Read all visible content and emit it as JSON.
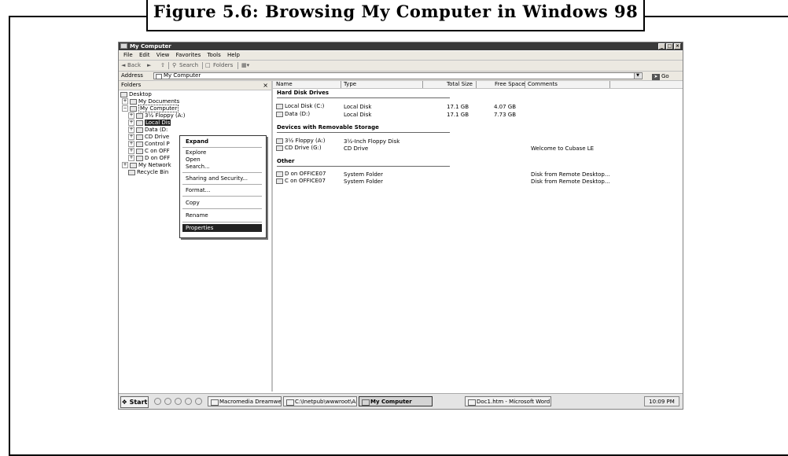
{
  "caption": "Figure 5.6: Browsing My Computer in Windows 98",
  "window": {
    "title": "My Computer",
    "controls": [
      "_",
      "□",
      "×"
    ]
  },
  "menu": [
    "File",
    "Edit",
    "View",
    "Favorites",
    "Tools",
    "Help"
  ],
  "toolbar": {
    "back": "Back",
    "search": "Search",
    "folders": "Folders"
  },
  "address": {
    "label": "Address",
    "value": "My Computer",
    "go": "Go"
  },
  "folders_pane": {
    "title": "Folders",
    "close": "×",
    "tree": [
      {
        "label": "Desktop",
        "exp": ""
      },
      {
        "label": "My Documents",
        "exp": "+"
      },
      {
        "label": "My Computer",
        "exp": "−"
      },
      {
        "label": "3½ Floppy (A:)",
        "exp": "+"
      },
      {
        "label": "Local Dis",
        "exp": "+"
      },
      {
        "label": "Data (D:",
        "exp": "+"
      },
      {
        "label": "CD Drive",
        "exp": "+"
      },
      {
        "label": "Control P",
        "exp": "+"
      },
      {
        "label": "C on OFF",
        "exp": "+"
      },
      {
        "label": "D on OFF",
        "exp": "+"
      },
      {
        "label": "My Network",
        "exp": "+"
      },
      {
        "label": "Recycle Bin",
        "exp": ""
      }
    ]
  },
  "context_menu": [
    "Expand",
    "Explore",
    "Open",
    "Search...",
    "Sharing and Security...",
    "Format...",
    "Copy",
    "Rename",
    "Properties"
  ],
  "columns": [
    "Name",
    "Type",
    "Total Size",
    "Free Space",
    "Comments"
  ],
  "groups": {
    "hard_disks": {
      "title": "Hard Disk Drives",
      "items": [
        {
          "name": "Local Disk (C:)",
          "type": "Local Disk",
          "total": "17.1 GB",
          "free": "4.07 GB",
          "comment": ""
        },
        {
          "name": "Data (D:)",
          "type": "Local Disk",
          "total": "17.1 GB",
          "free": "7.73 GB",
          "comment": ""
        }
      ]
    },
    "removable": {
      "title": "Devices with Removable Storage",
      "items": [
        {
          "name": "3½ Floppy (A:)",
          "type": "3½-Inch Floppy Disk",
          "total": "",
          "free": "",
          "comment": ""
        },
        {
          "name": "CD Drive (G:)",
          "type": "CD Drive",
          "total": "",
          "free": "",
          "comment": "Welcome to Cubase LE"
        }
      ]
    },
    "other": {
      "title": "Other",
      "items": [
        {
          "name": "D on OFFICE07",
          "type": "System Folder",
          "total": "",
          "free": "",
          "comment": "Disk from Remote Desktop..."
        },
        {
          "name": "C on OFFICE07",
          "type": "System Folder",
          "total": "",
          "free": "",
          "comment": "Disk from Remote Desktop..."
        }
      ]
    }
  },
  "taskbar": {
    "start": "Start",
    "buttons": [
      "Macromedia Dreamweav...",
      "C:\\Inetpub\\wwwroot\\Ar...",
      "My Computer",
      "Doc1.htm - Microsoft Word"
    ],
    "clock": "10:09 PM"
  }
}
